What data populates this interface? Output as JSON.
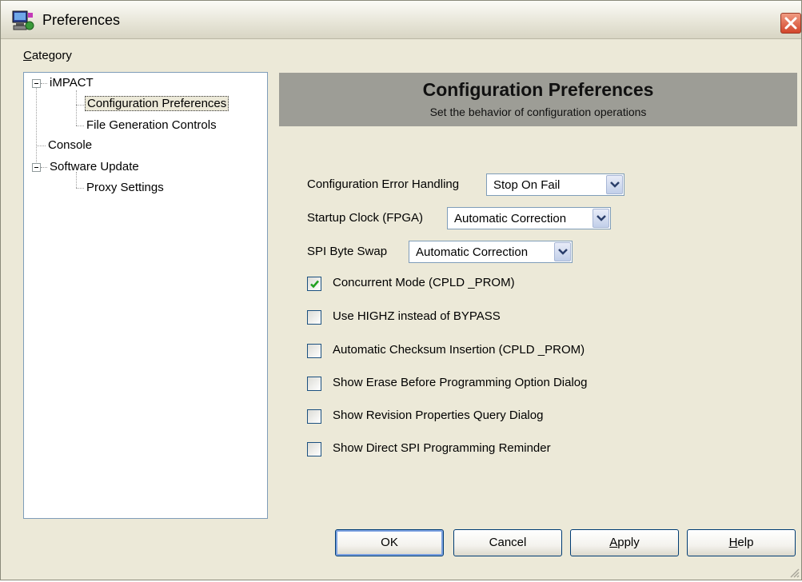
{
  "window": {
    "title": "Preferences",
    "accent": "#7aa0e0",
    "header_bg": "#9d9d96"
  },
  "category": {
    "label_access": "C",
    "label_rest": "ategory"
  },
  "tree": {
    "items": [
      {
        "label": "iMPACT",
        "expanded": true
      },
      {
        "label": "Configuration Preferences",
        "selected": true
      },
      {
        "label": "File Generation Controls"
      },
      {
        "label": "Console"
      },
      {
        "label": "Software Update",
        "expanded": true
      },
      {
        "label": "Proxy Settings"
      }
    ]
  },
  "panel": {
    "title": "Configuration Preferences",
    "subtitle": "Set the behavior of configuration operations"
  },
  "fields": {
    "error_handling": {
      "label": "Configuration Error Handling",
      "value": "Stop On Fail"
    },
    "startup_clock": {
      "label": "Startup Clock (FPGA)",
      "value": "Automatic Correction"
    },
    "spi_byte_swap": {
      "label": "SPI Byte Swap",
      "value": "Automatic Correction"
    }
  },
  "checkboxes": [
    {
      "label": "Concurrent Mode (CPLD _PROM)",
      "checked": true
    },
    {
      "label": "Use HIGHZ instead of BYPASS",
      "checked": false
    },
    {
      "label": "Automatic Checksum Insertion (CPLD _PROM)",
      "checked": false
    },
    {
      "label": "Show Erase Before Programming Option Dialog",
      "checked": false
    },
    {
      "label": "Show Revision Properties Query Dialog",
      "checked": false
    },
    {
      "label": "Show Direct SPI Programming Reminder",
      "checked": false
    }
  ],
  "buttons": {
    "ok": "OK",
    "cancel": "Cancel",
    "apply_access": "A",
    "apply_rest": "pply",
    "help_access": "H",
    "help_rest": "elp"
  }
}
